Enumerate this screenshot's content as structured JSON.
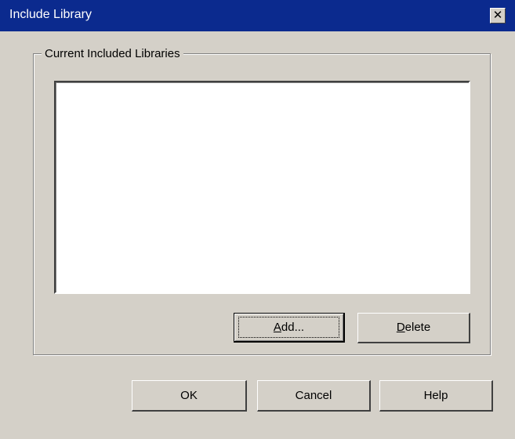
{
  "window": {
    "title": "Include Library",
    "close_glyph": "✕",
    "close_icon": "close-icon"
  },
  "group": {
    "label": "Current Included Libraries",
    "items": []
  },
  "buttons": {
    "add": {
      "mnemonic": "A",
      "rest": "dd..."
    },
    "delete": {
      "mnemonic": "D",
      "rest": "elete"
    },
    "ok": "OK",
    "cancel": "Cancel",
    "help": "Help"
  },
  "colors": {
    "titlebar": "#0b2a8e",
    "face": "#d4d0c8"
  }
}
